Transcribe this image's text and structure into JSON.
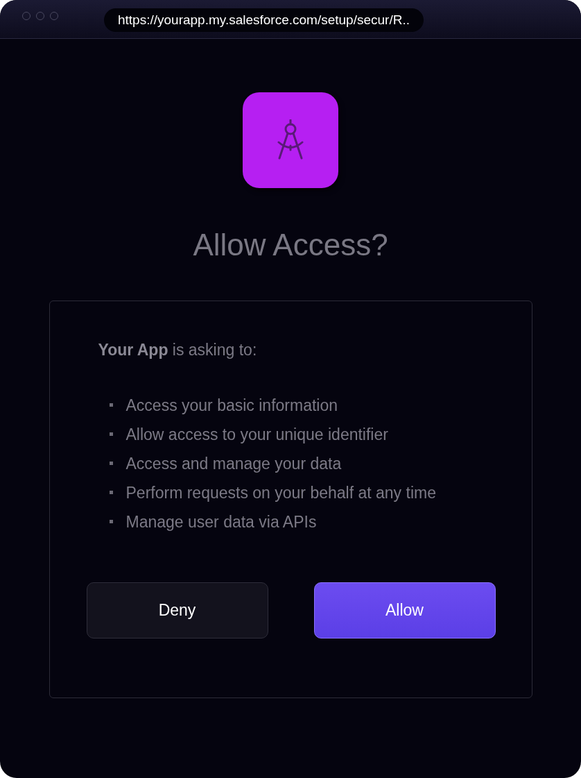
{
  "browser": {
    "url": "https://yourapp.my.salesforce.com/setup/secur/R.."
  },
  "dialog": {
    "title": "Allow Access?",
    "intro": "**Your App** is asking to:",
    "permissions": [
      "Access your basic information",
      "Allow access to your unique identifier",
      "Access and manage your data",
      "Perform requests on your behalf at any time",
      "Manage user data via APIs"
    ],
    "buttons": [
      {
        "label": "Deny",
        "kind": "secondary"
      },
      {
        "label": "Allow",
        "kind": "primary"
      }
    ]
  }
}
